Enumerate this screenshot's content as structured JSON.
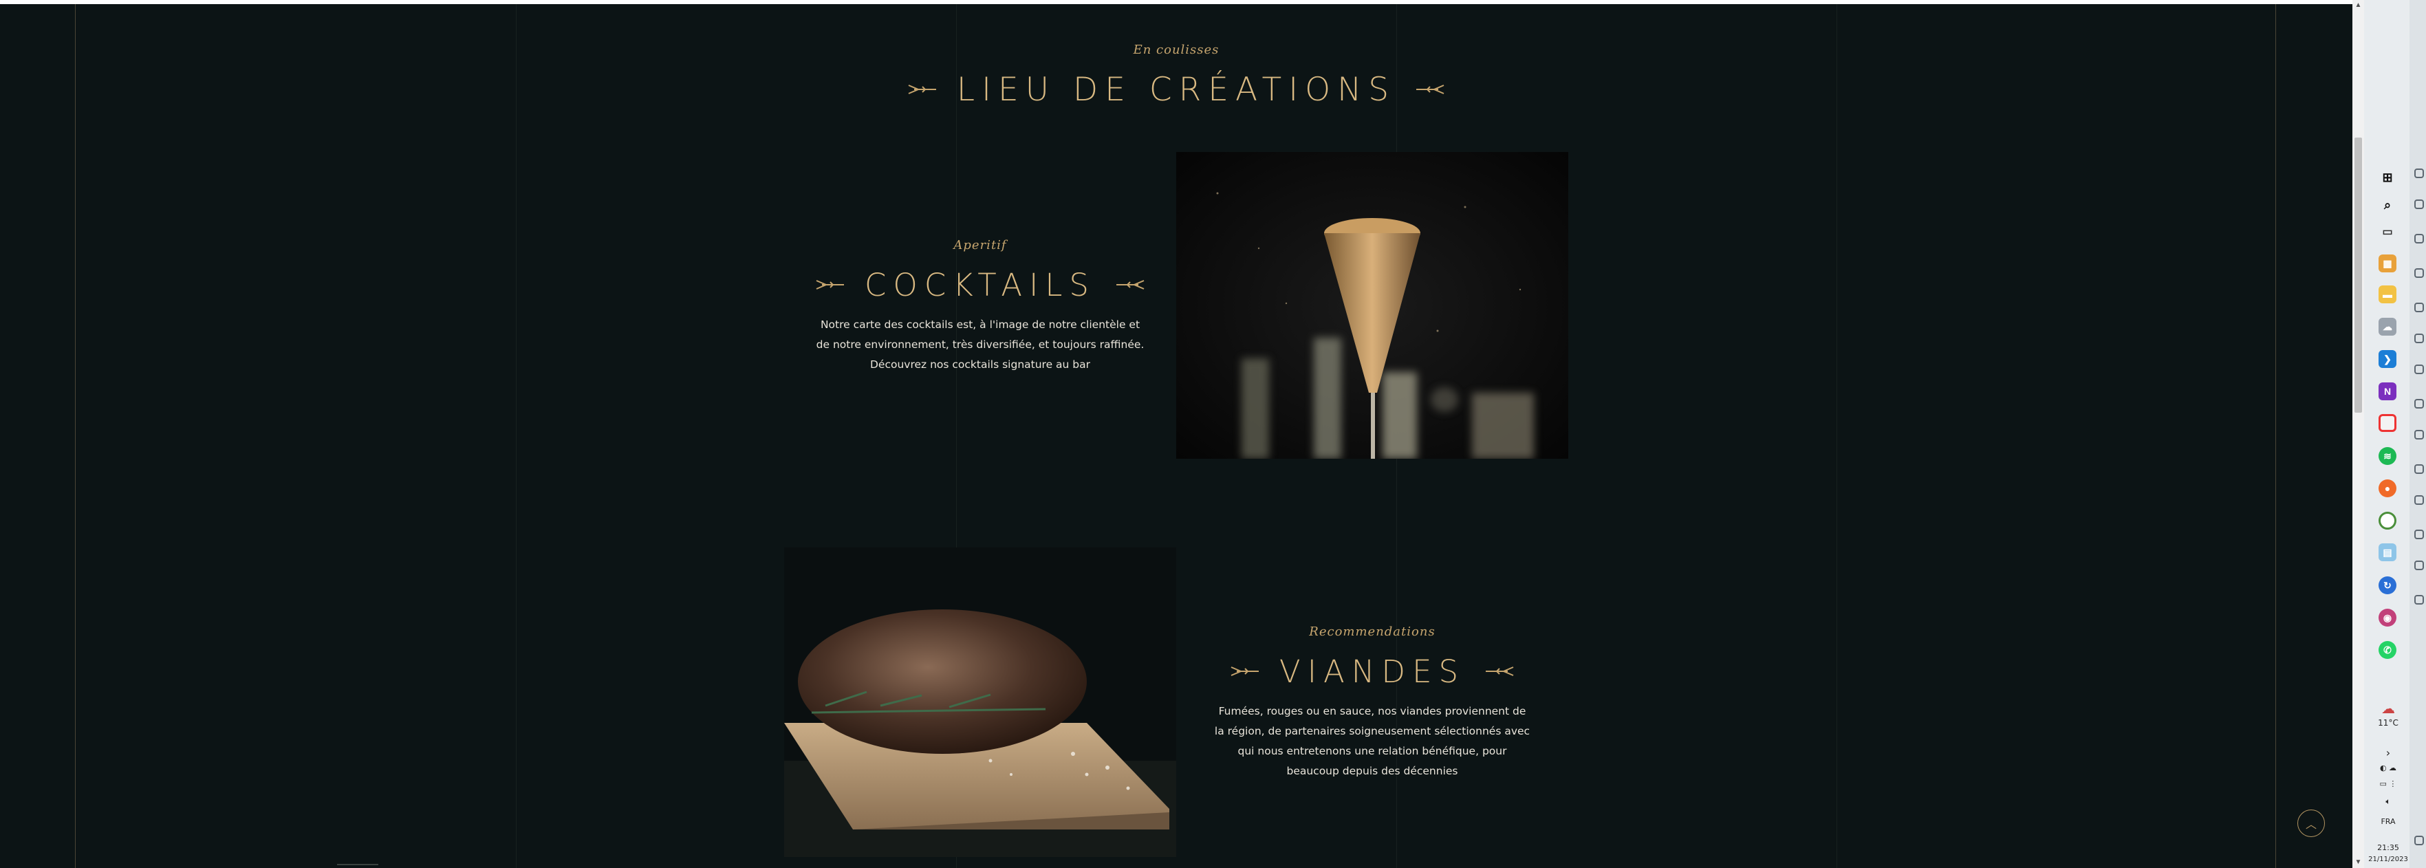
{
  "section": {
    "eyebrow": "En coulisses",
    "title": "LIEU DE CRÉATIONS"
  },
  "cocktails": {
    "eyebrow": "Aperitif",
    "title": "COCKTAILS",
    "description_lines": [
      "Notre carte des cocktails est, à l'image de notre clientèle et",
      "de notre environnement, très diversifiée, et toujours raffinée.",
      "Découvrez nos cocktails signature au bar"
    ]
  },
  "viandes": {
    "eyebrow": "Recommendations",
    "title": "VIANDES",
    "description_lines": [
      "Fumées, rouges ou en sauce, nos viandes proviennent de",
      "la région, de partenaires soigneusement sélectionnés avec",
      "qui nous entretenons une relation bénéfique, pour",
      "beaucoup depuis des décennies"
    ]
  },
  "taskbar": {
    "weather": "11°C",
    "lang": "FRA",
    "time": "21:35",
    "date": "21/11/2023"
  },
  "colors": {
    "page_background": "#0c1415",
    "gold_accent": "#d9b982",
    "text_light": "#e9e4da"
  },
  "icons": [
    "scroll-to-top-icon",
    "windows-start-icon",
    "search-icon",
    "task-view-icon",
    "chrome-icon",
    "vscode-icon",
    "spotify-icon",
    "whatsapp-icon"
  ]
}
